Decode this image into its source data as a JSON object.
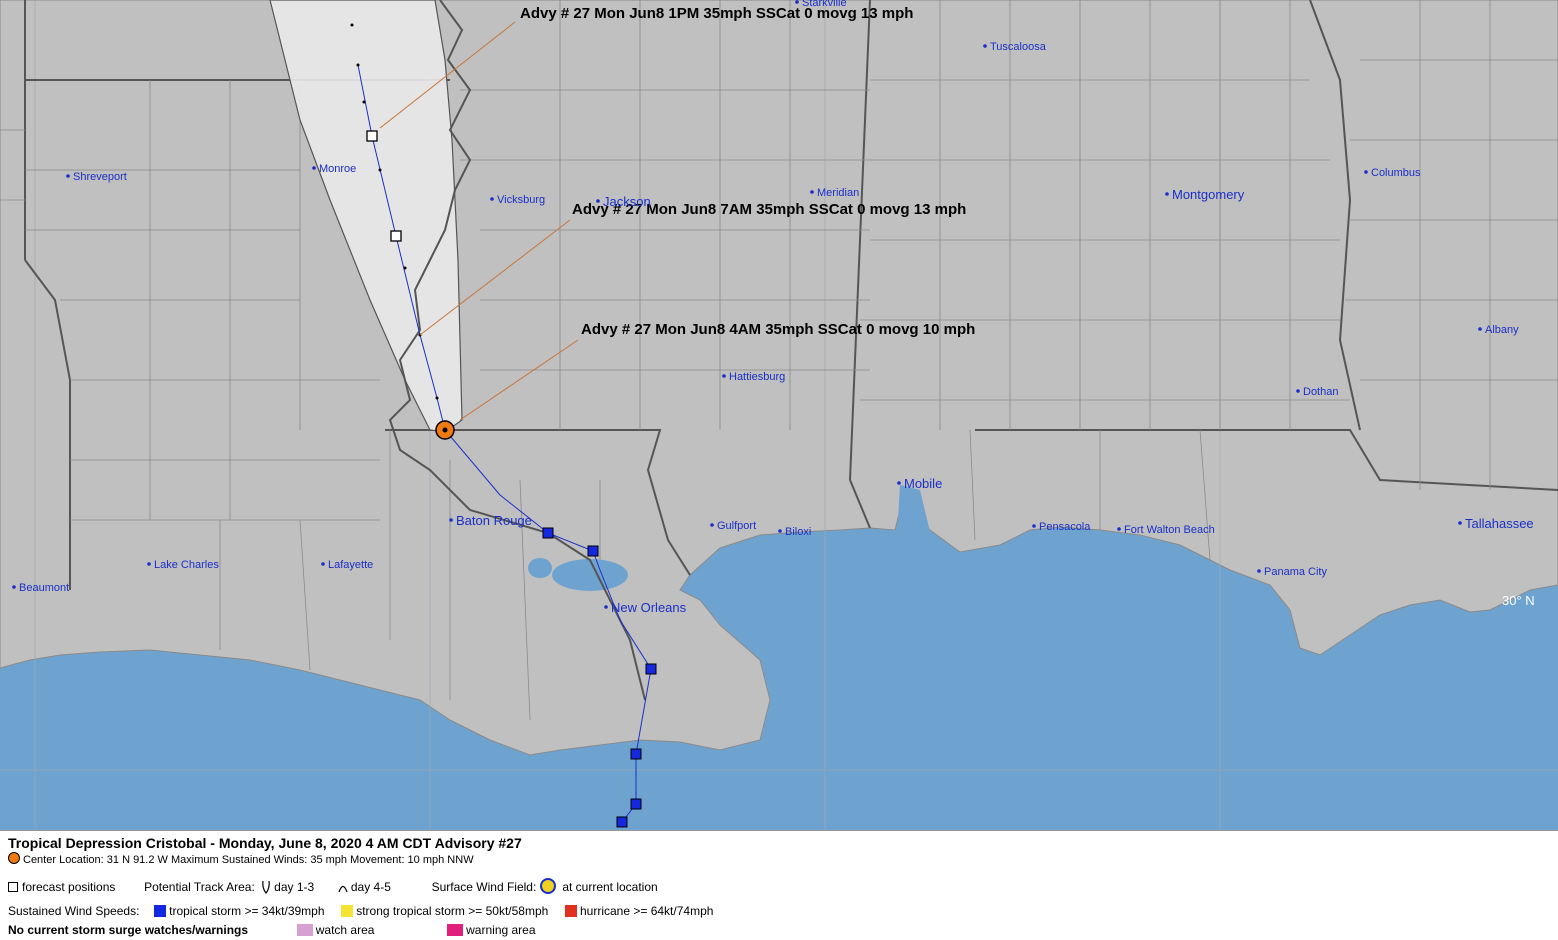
{
  "map": {
    "cities": [
      {
        "name": "Shreveport",
        "size": "small"
      },
      {
        "name": "Monroe",
        "size": "small"
      },
      {
        "name": "Vicksburg",
        "size": "small"
      },
      {
        "name": "Jackson",
        "size": "large"
      },
      {
        "name": "Meridian",
        "size": "small"
      },
      {
        "name": "Tuscaloosa",
        "size": "small"
      },
      {
        "name": "Starkville",
        "size": "small"
      },
      {
        "name": "Montgomery",
        "size": "large"
      },
      {
        "name": "Columbus",
        "size": "small"
      },
      {
        "name": "Albany",
        "size": "small"
      },
      {
        "name": "Dothan",
        "size": "small"
      },
      {
        "name": "Hattiesburg",
        "size": "small"
      },
      {
        "name": "Mobile",
        "size": "large"
      },
      {
        "name": "Gulfport",
        "size": "small"
      },
      {
        "name": "Biloxi",
        "size": "small"
      },
      {
        "name": "Pensacola",
        "size": "small"
      },
      {
        "name": "Fort Walton Beach",
        "size": "small"
      },
      {
        "name": "Panama City",
        "size": "small"
      },
      {
        "name": "Tallahassee",
        "size": "large"
      },
      {
        "name": "Baton Rouge",
        "size": "large"
      },
      {
        "name": "New Orleans",
        "size": "large"
      },
      {
        "name": "Lake Charles",
        "size": "small"
      },
      {
        "name": "Lafayette",
        "size": "small"
      },
      {
        "name": "Beaumont",
        "size": "small"
      }
    ],
    "lat_label": "30° N",
    "advisories": [
      "Advy # 27 Mon Jun8 1PM  35mph SSCat 0 movg 13 mph",
      "Advy # 27 Mon Jun8 7AM  35mph SSCat 0 movg 13 mph",
      "Advy # 27 Mon Jun8 4AM  35mph SSCat 0 movg 10 mph"
    ],
    "colors": {
      "water": "#6fa3cf",
      "land": "#c0c0c0",
      "cone": "#e8e8e8",
      "track": "#1a2fc8",
      "storm_center": "#f07a10"
    }
  },
  "legend": {
    "title": "Tropical Depression Cristobal  -  Monday, June 8, 2020  4 AM CDT   Advisory #27",
    "center": "Center Location: 31 N  91.2 W   Maximum Sustained Winds: 35 mph  Movement: 10 mph NNW",
    "forecast_positions": "forecast positions",
    "potential_track": "Potential Track Area:",
    "day13": "day 1-3",
    "day45": "day 4-5",
    "surface_wind": "Surface Wind Field:",
    "at_current": "at current location",
    "sustained": "Sustained Wind Speeds:",
    "ts": "tropical storm >= 34kt/39mph",
    "sts": "strong tropical storm >= 50kt/58mph",
    "hu": "hurricane >= 64kt/74mph",
    "no_surge": "No current storm surge watches/warnings",
    "watch": "watch area",
    "warning": "warning area",
    "swatch_colors": {
      "ts": "#1428e0",
      "sts": "#f5e332",
      "hu": "#e0301e",
      "watch": "#d8a0d0",
      "warning": "#e0207a"
    }
  }
}
